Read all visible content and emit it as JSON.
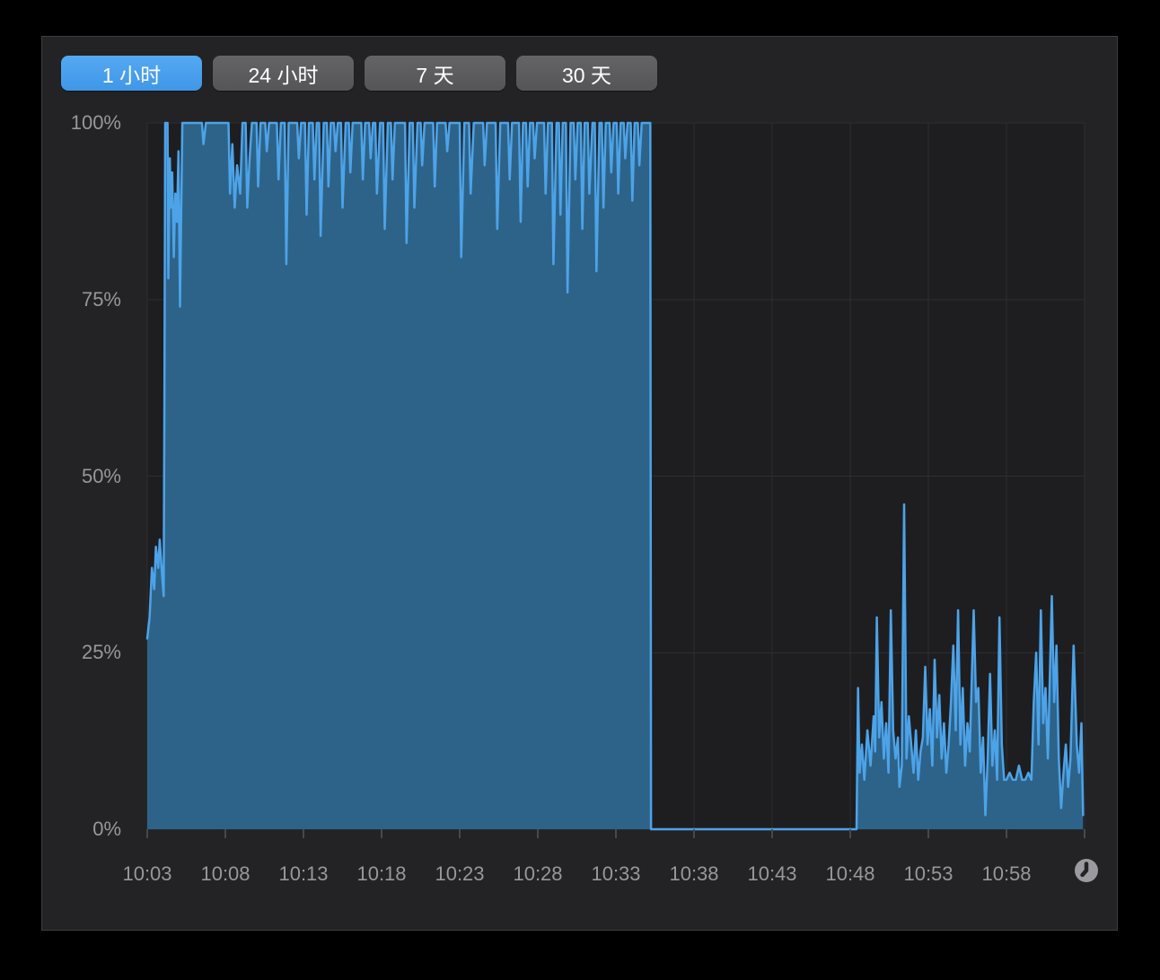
{
  "window": {
    "background": "#000000"
  },
  "panel": {
    "background": "#232325",
    "border": "#3d3d40"
  },
  "time_range_buttons": [
    {
      "id": "1h",
      "label": "1 小时",
      "selected": true
    },
    {
      "id": "24h",
      "label": "24 小时",
      "selected": false
    },
    {
      "id": "7d",
      "label": "7 天",
      "selected": false
    },
    {
      "id": "30d",
      "label": "30 天",
      "selected": false
    }
  ],
  "icons": {
    "clock": "clock-icon"
  },
  "colors": {
    "accent_blue": "#47a1ec",
    "button_gray": "#59595b",
    "area_fill": "#2d6389",
    "line": "#4da3e8",
    "plot_background": "#1e1e20",
    "grid": "#2e2e31",
    "axis_label": "#97979c",
    "tick_mark": "#48484b",
    "clock_icon": "#9a9aa0"
  },
  "chart_data": {
    "type": "area",
    "x_tick_labels": [
      "10:03",
      "10:08",
      "10:13",
      "10:18",
      "10:23",
      "10:28",
      "10:33",
      "10:38",
      "10:43",
      "10:48",
      "10:53",
      "10:58"
    ],
    "x_axis_span_minutes": 60,
    "x_tick_interval_minutes": 5,
    "y_tick_labels": [
      "0%",
      "25%",
      "50%",
      "75%",
      "100%"
    ],
    "y_range": [
      0,
      100
    ],
    "grid": true,
    "legend": false,
    "series": [
      {
        "name": "usage-percent",
        "unit": "%",
        "points_minutes_percent": [
          [
            0,
            27
          ],
          [
            0.15,
            30
          ],
          [
            0.3,
            37
          ],
          [
            0.45,
            34
          ],
          [
            0.55,
            40
          ],
          [
            0.7,
            37
          ],
          [
            0.8,
            41
          ],
          [
            0.95,
            36
          ],
          [
            1.05,
            33
          ],
          [
            1.1,
            60
          ],
          [
            1.15,
            100
          ],
          [
            1.3,
            100
          ],
          [
            1.35,
            78
          ],
          [
            1.45,
            95
          ],
          [
            1.5,
            88
          ],
          [
            1.6,
            93
          ],
          [
            1.7,
            81
          ],
          [
            1.8,
            90
          ],
          [
            1.9,
            86
          ],
          [
            2.0,
            96
          ],
          [
            2.1,
            74
          ],
          [
            2.25,
            100
          ],
          [
            3.5,
            100
          ],
          [
            3.6,
            97
          ],
          [
            3.75,
            100
          ],
          [
            5.2,
            100
          ],
          [
            5.3,
            90
          ],
          [
            5.45,
            97
          ],
          [
            5.6,
            88
          ],
          [
            5.75,
            94
          ],
          [
            5.95,
            90
          ],
          [
            6.1,
            100
          ],
          [
            6.3,
            100
          ],
          [
            6.4,
            88
          ],
          [
            6.55,
            95
          ],
          [
            6.7,
            100
          ],
          [
            7.0,
            100
          ],
          [
            7.1,
            91
          ],
          [
            7.25,
            100
          ],
          [
            7.55,
            100
          ],
          [
            7.65,
            96
          ],
          [
            7.8,
            100
          ],
          [
            8.3,
            100
          ],
          [
            8.4,
            92
          ],
          [
            8.55,
            100
          ],
          [
            8.8,
            100
          ],
          [
            8.9,
            80
          ],
          [
            9.05,
            100
          ],
          [
            9.6,
            100
          ],
          [
            9.7,
            95
          ],
          [
            9.85,
            100
          ],
          [
            10.1,
            100
          ],
          [
            10.2,
            87
          ],
          [
            10.35,
            100
          ],
          [
            10.6,
            100
          ],
          [
            10.7,
            92
          ],
          [
            10.85,
            100
          ],
          [
            11.0,
            100
          ],
          [
            11.1,
            84
          ],
          [
            11.3,
            100
          ],
          [
            11.5,
            100
          ],
          [
            11.6,
            91
          ],
          [
            11.75,
            100
          ],
          [
            11.95,
            100
          ],
          [
            12.05,
            96
          ],
          [
            12.2,
            100
          ],
          [
            12.4,
            100
          ],
          [
            12.5,
            88
          ],
          [
            12.7,
            100
          ],
          [
            12.9,
            100
          ],
          [
            13.0,
            93
          ],
          [
            13.15,
            100
          ],
          [
            13.7,
            100
          ],
          [
            13.8,
            92
          ],
          [
            13.95,
            100
          ],
          [
            14.2,
            100
          ],
          [
            14.3,
            95
          ],
          [
            14.45,
            100
          ],
          [
            14.6,
            100
          ],
          [
            14.7,
            90
          ],
          [
            14.9,
            100
          ],
          [
            15.1,
            100
          ],
          [
            15.2,
            85
          ],
          [
            15.4,
            100
          ],
          [
            15.6,
            100
          ],
          [
            15.7,
            92
          ],
          [
            15.85,
            100
          ],
          [
            16.5,
            100
          ],
          [
            16.6,
            83
          ],
          [
            16.8,
            100
          ],
          [
            17.0,
            100
          ],
          [
            17.1,
            88
          ],
          [
            17.3,
            100
          ],
          [
            17.5,
            100
          ],
          [
            17.6,
            94
          ],
          [
            17.75,
            100
          ],
          [
            18.3,
            100
          ],
          [
            18.4,
            91
          ],
          [
            18.55,
            100
          ],
          [
            19.1,
            100
          ],
          [
            19.2,
            96
          ],
          [
            19.35,
            100
          ],
          [
            20.0,
            100
          ],
          [
            20.1,
            81
          ],
          [
            20.3,
            100
          ],
          [
            20.6,
            100
          ],
          [
            20.7,
            90
          ],
          [
            20.9,
            100
          ],
          [
            21.5,
            100
          ],
          [
            21.6,
            94
          ],
          [
            21.75,
            100
          ],
          [
            22.3,
            100
          ],
          [
            22.4,
            85
          ],
          [
            22.6,
            100
          ],
          [
            23.1,
            100
          ],
          [
            23.2,
            92
          ],
          [
            23.35,
            100
          ],
          [
            23.8,
            100
          ],
          [
            23.9,
            86
          ],
          [
            24.05,
            100
          ],
          [
            24.25,
            100
          ],
          [
            24.35,
            91
          ],
          [
            24.5,
            100
          ],
          [
            24.7,
            100
          ],
          [
            24.8,
            95
          ],
          [
            24.95,
            100
          ],
          [
            25.4,
            100
          ],
          [
            25.5,
            90
          ],
          [
            25.65,
            100
          ],
          [
            25.9,
            100
          ],
          [
            26.0,
            80
          ],
          [
            26.2,
            100
          ],
          [
            26.35,
            100
          ],
          [
            26.45,
            87
          ],
          [
            26.6,
            100
          ],
          [
            26.8,
            100
          ],
          [
            26.9,
            76
          ],
          [
            27.1,
            100
          ],
          [
            27.3,
            100
          ],
          [
            27.4,
            92
          ],
          [
            27.55,
            100
          ],
          [
            27.75,
            100
          ],
          [
            27.85,
            85
          ],
          [
            28.0,
            100
          ],
          [
            28.2,
            100
          ],
          [
            28.3,
            90
          ],
          [
            28.5,
            100
          ],
          [
            28.65,
            100
          ],
          [
            28.75,
            79
          ],
          [
            28.95,
            100
          ],
          [
            29.1,
            100
          ],
          [
            29.2,
            88
          ],
          [
            29.35,
            100
          ],
          [
            29.6,
            100
          ],
          [
            29.7,
            93
          ],
          [
            29.85,
            100
          ],
          [
            30.05,
            100
          ],
          [
            30.15,
            90
          ],
          [
            30.3,
            100
          ],
          [
            30.5,
            100
          ],
          [
            30.6,
            95
          ],
          [
            30.75,
            100
          ],
          [
            30.95,
            100
          ],
          [
            31.05,
            89
          ],
          [
            31.2,
            100
          ],
          [
            31.4,
            100
          ],
          [
            31.5,
            94
          ],
          [
            31.65,
            100
          ],
          [
            32.2,
            100
          ],
          [
            32.25,
            0
          ],
          [
            45.4,
            0
          ],
          [
            45.5,
            20
          ],
          [
            45.6,
            8
          ],
          [
            45.75,
            12
          ],
          [
            45.9,
            7
          ],
          [
            46.1,
            14
          ],
          [
            46.3,
            9
          ],
          [
            46.5,
            16
          ],
          [
            46.6,
            11
          ],
          [
            46.7,
            30
          ],
          [
            46.85,
            13
          ],
          [
            47.0,
            18
          ],
          [
            47.15,
            10
          ],
          [
            47.3,
            15
          ],
          [
            47.45,
            8
          ],
          [
            47.6,
            31
          ],
          [
            47.75,
            14
          ],
          [
            47.9,
            10
          ],
          [
            48.05,
            13
          ],
          [
            48.15,
            6
          ],
          [
            48.3,
            9
          ],
          [
            48.45,
            46
          ],
          [
            48.6,
            10
          ],
          [
            48.75,
            16
          ],
          [
            48.9,
            12
          ],
          [
            49.05,
            8
          ],
          [
            49.2,
            14
          ],
          [
            49.35,
            7
          ],
          [
            49.5,
            11
          ],
          [
            49.65,
            13
          ],
          [
            49.8,
            23
          ],
          [
            49.95,
            12
          ],
          [
            50.1,
            17
          ],
          [
            50.25,
            9
          ],
          [
            50.4,
            24
          ],
          [
            50.55,
            13
          ],
          [
            50.7,
            19
          ],
          [
            50.85,
            10
          ],
          [
            51.0,
            15
          ],
          [
            51.15,
            8
          ],
          [
            51.3,
            12
          ],
          [
            51.45,
            18
          ],
          [
            51.6,
            26
          ],
          [
            51.75,
            14
          ],
          [
            51.9,
            31
          ],
          [
            52.05,
            12
          ],
          [
            52.2,
            20
          ],
          [
            52.35,
            9
          ],
          [
            52.5,
            15
          ],
          [
            52.65,
            11
          ],
          [
            52.9,
            31
          ],
          [
            53.05,
            18
          ],
          [
            53.2,
            20
          ],
          [
            53.35,
            8
          ],
          [
            53.5,
            13
          ],
          [
            53.65,
            2
          ],
          [
            53.8,
            10
          ],
          [
            53.95,
            22
          ],
          [
            54.1,
            9
          ],
          [
            54.25,
            14
          ],
          [
            54.4,
            7
          ],
          [
            54.55,
            30
          ],
          [
            54.7,
            12
          ],
          [
            54.85,
            7
          ],
          [
            55.0,
            7
          ],
          [
            55.2,
            8
          ],
          [
            55.4,
            7
          ],
          [
            55.6,
            7
          ],
          [
            55.8,
            9
          ],
          [
            56.0,
            7
          ],
          [
            56.2,
            7
          ],
          [
            56.4,
            8
          ],
          [
            56.6,
            7
          ],
          [
            56.75,
            18
          ],
          [
            56.9,
            25
          ],
          [
            57.05,
            12
          ],
          [
            57.2,
            31
          ],
          [
            57.35,
            15
          ],
          [
            57.5,
            20
          ],
          [
            57.65,
            10
          ],
          [
            57.9,
            33
          ],
          [
            58.05,
            18
          ],
          [
            58.2,
            26
          ],
          [
            58.35,
            10
          ],
          [
            58.5,
            3
          ],
          [
            58.65,
            8
          ],
          [
            58.8,
            12
          ],
          [
            58.95,
            6
          ],
          [
            59.1,
            10
          ],
          [
            59.3,
            26
          ],
          [
            59.5,
            12
          ],
          [
            59.65,
            8
          ],
          [
            59.8,
            15
          ],
          [
            59.9,
            2
          ]
        ]
      }
    ]
  }
}
